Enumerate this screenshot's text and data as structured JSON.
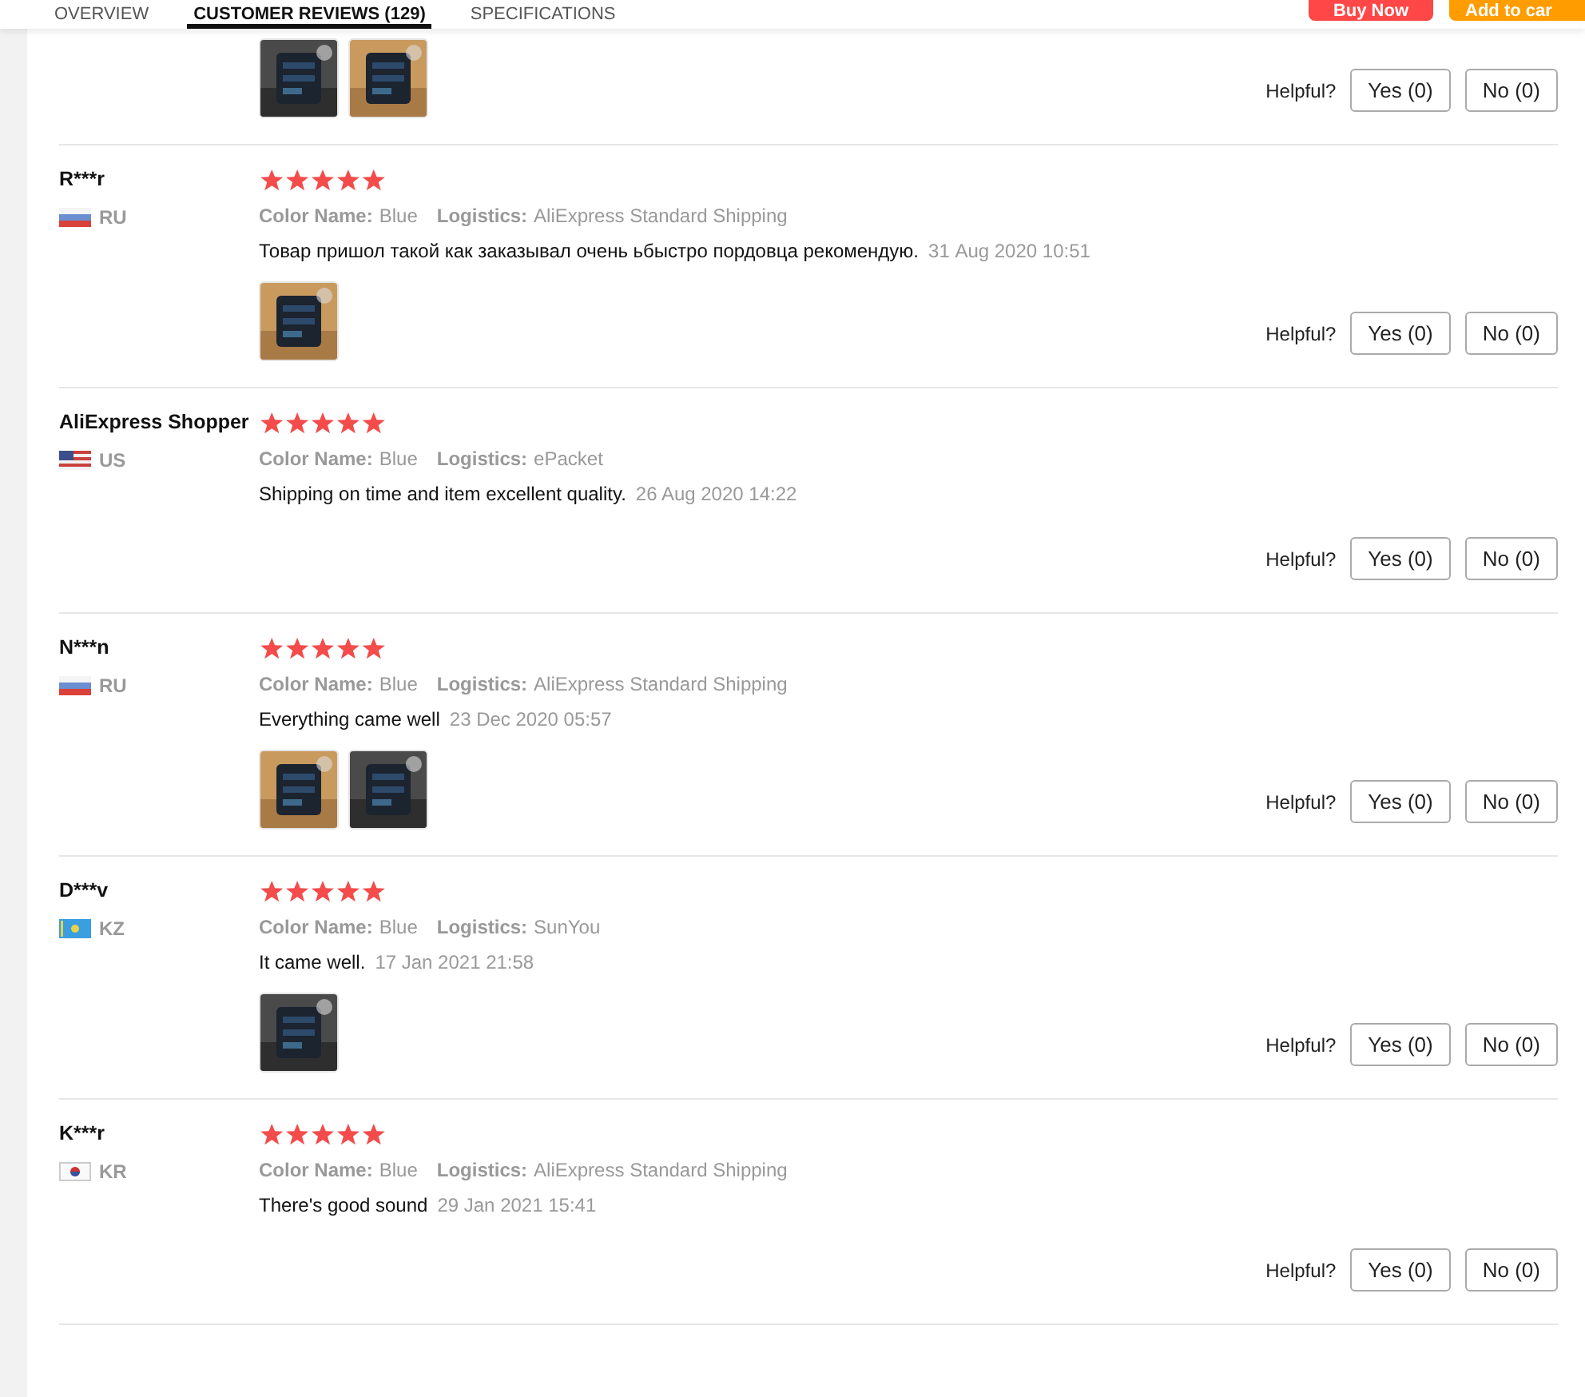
{
  "tabs": [
    {
      "label": "OVERVIEW",
      "selected": false
    },
    {
      "label": "CUSTOMER REVIEWS (129)",
      "selected": true
    },
    {
      "label": "SPECIFICATIONS",
      "selected": false
    }
  ],
  "actions": [
    {
      "label": "Buy Now",
      "kind": "buy"
    },
    {
      "label": "Add to car",
      "kind": "cart"
    }
  ],
  "reviews": [
    {
      "images": [
        {
          "kind": "picture"
        },
        {
          "kind": "picture"
        }
      ],
      "helpful_label": "Helpful?",
      "yes": "Yes (0)",
      "no": "No (0)"
    },
    {
      "name": "R***r",
      "country": "RU",
      "stars": 5,
      "color_label": "Color Name:",
      "color_value": "Blue",
      "logistics_label": "Logistics:",
      "logistics_value": "AliExpress Standard Shipping",
      "text": "Товар пришол такой как заказывал очень ьбыстро пордовца рекомендую.",
      "date": "31 Aug 2020 10:51",
      "images": [
        {
          "kind": "picture"
        }
      ],
      "helpful_label": "Helpful?",
      "yes": "Yes (0)",
      "no": "No (0)"
    },
    {
      "name": "AliExpress Shopper",
      "country": "US",
      "stars": 5,
      "color_label": "Color Name:",
      "color_value": "Blue",
      "logistics_label": "Logistics:",
      "logistics_value": "ePacket",
      "text": "Shipping on time and item excellent quality.",
      "date": "26 Aug 2020 14:22",
      "helpful_label": "Helpful?",
      "yes": "Yes (0)",
      "no": "No (0)"
    },
    {
      "name": "N***n",
      "country": "RU",
      "stars": 5,
      "color_label": "Color Name:",
      "color_value": "Blue",
      "logistics_label": "Logistics:",
      "logistics_value": "AliExpress Standard Shipping",
      "text": "Everything came well",
      "date": "23 Dec 2020 05:57",
      "images": [
        {
          "kind": "picture"
        },
        {
          "kind": "picture"
        }
      ],
      "helpful_label": "Helpful?",
      "yes": "Yes (0)",
      "no": "No (0)"
    },
    {
      "name": "D***v",
      "country": "KZ",
      "stars": 5,
      "color_label": "Color Name:",
      "color_value": "Blue",
      "logistics_label": "Logistics:",
      "logistics_value": "SunYou",
      "text": "It came well.",
      "date": "17 Jan 2021 21:58",
      "images": [
        {
          "kind": "picture"
        }
      ],
      "helpful_label": "Helpful?",
      "yes": "Yes (0)",
      "no": "No (0)"
    },
    {
      "name": "K***r",
      "country": "KR",
      "stars": 5,
      "color_label": "Color Name:",
      "color_value": "Blue",
      "logistics_label": "Logistics:",
      "logistics_value": "AliExpress Standard Shipping",
      "text": "There's good sound",
      "date": "29 Jan 2021 15:41",
      "helpful_label": "Helpful?",
      "yes": "Yes (0)",
      "no": "No (0)"
    }
  ]
}
